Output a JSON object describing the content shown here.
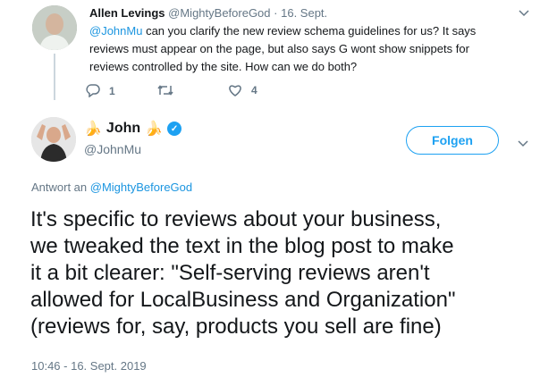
{
  "reply": {
    "name": "Allen Levings",
    "handle": "@MightyBeforeGod",
    "separator": "·",
    "date": "16. Sept.",
    "mention": "@JohnMu",
    "text_line1": " can you clarify the new review schema guidelines for us? It says",
    "text_line2": "reviews must appear on the page, but also says G wont show snippets for",
    "text_line3": "reviews controlled by the site. How can we do both?",
    "reply_count": "1",
    "retweet_count": "",
    "like_count": "4"
  },
  "main": {
    "emoji_left": "🍌",
    "name": "John",
    "emoji_right": "🍌",
    "handle": "@JohnMu",
    "follow_label": "Folgen",
    "reply_to_prefix": "Antwort an ",
    "reply_to_handle": "@MightyBeforeGod",
    "body_line1": "It's specific to reviews about your business,",
    "body_line2": "we tweaked the text in the blog post to make",
    "body_line3": "it a bit clearer: \"Self-serving reviews aren't",
    "body_line4": "allowed for LocalBusiness and Organization\"",
    "body_line5": "(reviews for, say, products you sell are fine)",
    "timestamp": "10:46 - 16. Sept. 2019"
  },
  "colors": {
    "link": "#1b95e0",
    "accent": "#1da1f2",
    "muted": "#657786"
  }
}
